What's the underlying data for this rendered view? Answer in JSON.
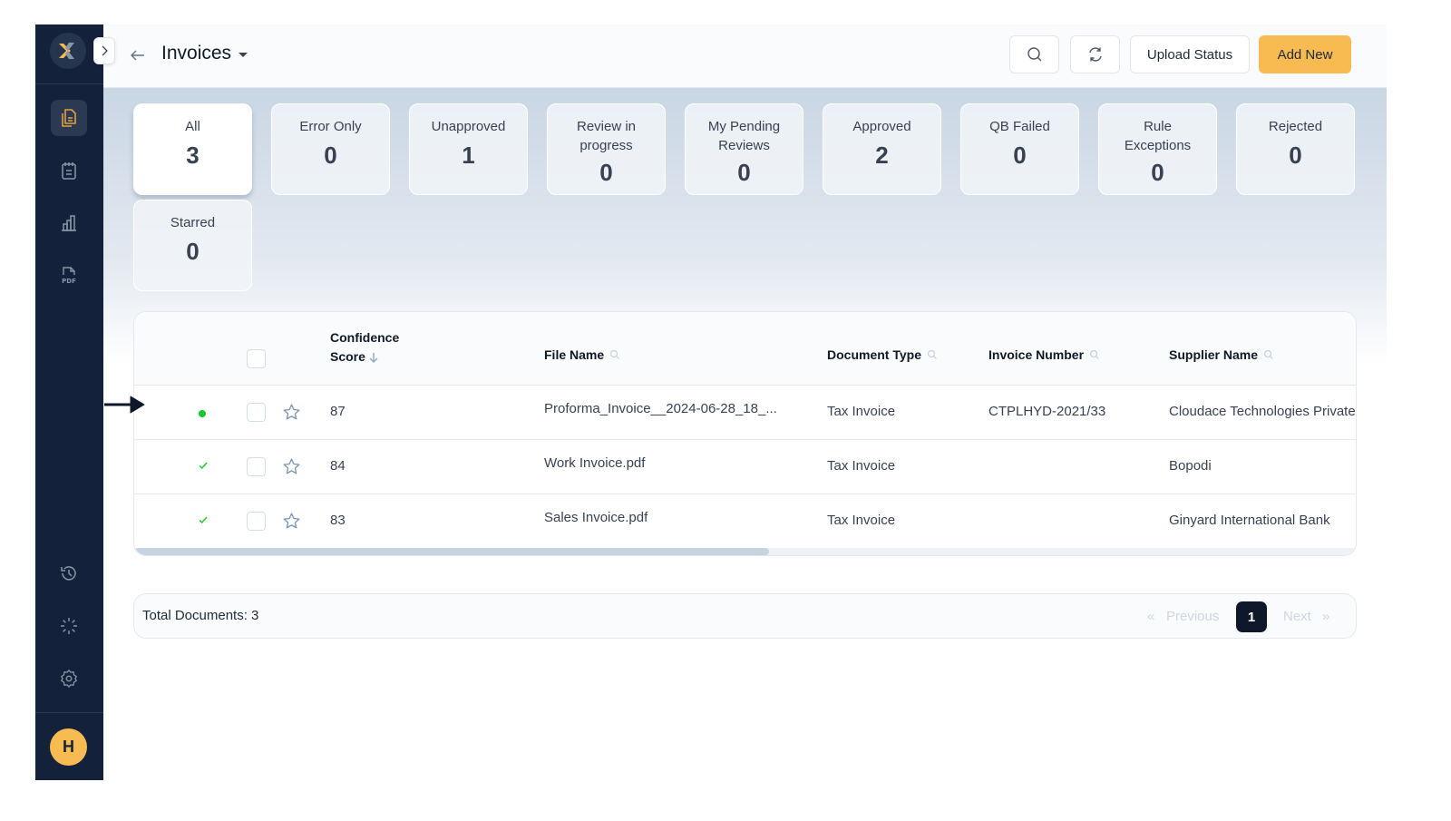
{
  "header": {
    "title": "Invoices",
    "buttons": {
      "search": "search-icon",
      "refresh": "refresh-icon",
      "upload_status": "Upload Status",
      "add_new": "Add New"
    }
  },
  "sidebar": {
    "logo": "X",
    "items": [
      {
        "icon": "documents-icon",
        "active": true
      },
      {
        "icon": "notepad-icon",
        "active": false
      },
      {
        "icon": "bar-chart-icon",
        "active": false
      },
      {
        "icon": "pdf-icon",
        "active": false
      },
      {
        "icon": "history-icon",
        "active": false
      },
      {
        "icon": "loader-icon",
        "active": false
      },
      {
        "icon": "settings-icon",
        "active": false
      }
    ],
    "avatar_initial": "H"
  },
  "filters": [
    {
      "label": "All",
      "count": "3",
      "active": true
    },
    {
      "label": "Error Only",
      "count": "0"
    },
    {
      "label": "Unapproved",
      "count": "1"
    },
    {
      "label": "Review in progress",
      "count": "0"
    },
    {
      "label": "My Pending Reviews",
      "count": "0"
    },
    {
      "label": "Approved",
      "count": "2"
    },
    {
      "label": "QB Failed",
      "count": "0"
    },
    {
      "label": "Rule Exceptions",
      "count": "0"
    },
    {
      "label": "Rejected",
      "count": "0"
    },
    {
      "label": "Starred",
      "count": "0"
    }
  ],
  "table": {
    "columns": {
      "confidence_line1": "Confidence",
      "confidence_line2": "Score",
      "file_name": "File Name",
      "document_type": "Document Type",
      "invoice_number": "Invoice Number",
      "supplier_name": "Supplier Name"
    },
    "rows": [
      {
        "status": "processing",
        "confidence": "87",
        "file_name": "Proforma_Invoice__2024-06-28_18_...",
        "document_type": "Tax Invoice",
        "invoice_number": "CTPLHYD-2021/33",
        "supplier_name": "Cloudace Technologies Private"
      },
      {
        "status": "approved",
        "confidence": "84",
        "file_name": "Work Invoice.pdf",
        "document_type": "Tax Invoice",
        "invoice_number": "",
        "supplier_name": "Bopodi"
      },
      {
        "status": "approved",
        "confidence": "83",
        "file_name": "Sales Invoice.pdf",
        "document_type": "Tax Invoice",
        "invoice_number": "",
        "supplier_name": "Ginyard International Bank"
      }
    ]
  },
  "footer": {
    "total_documents": "Total Documents: 3",
    "pagination": {
      "prev_symbol": "«",
      "previous": "Previous",
      "current_page": "1",
      "next": "Next",
      "next_symbol": "»"
    }
  },
  "colors": {
    "sidebar_bg": "#14213a",
    "accent": "#f8bb52",
    "status_green": "#16c92b",
    "page_active_bg": "#0f172a"
  }
}
